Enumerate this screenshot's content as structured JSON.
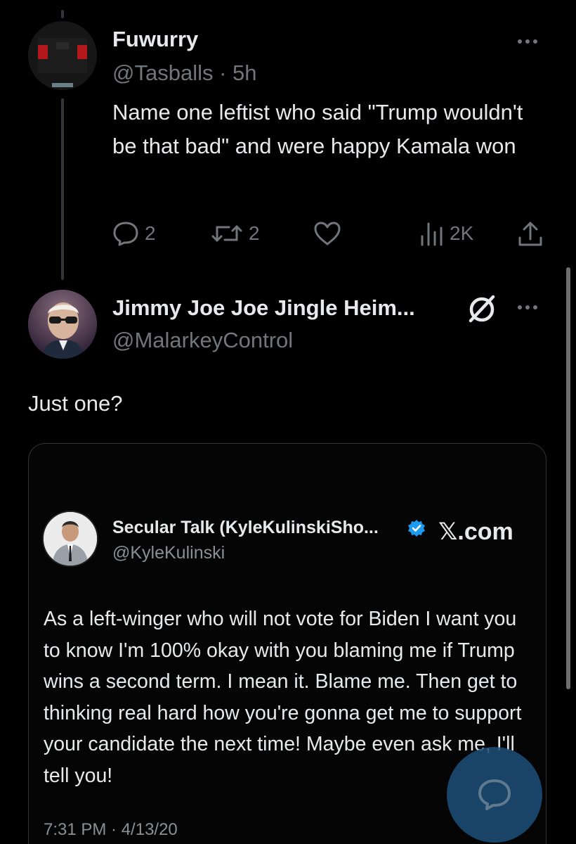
{
  "tweet1": {
    "name": "Fuwurry",
    "handle_time": "@Tasballs · 5h",
    "text": "Name one leftist who said \"Trump wouldn't be that bad\" and were happy Kamala won",
    "replies": "2",
    "retweets": "2",
    "views": "2K"
  },
  "tweet2": {
    "name": "Jimmy Joe Joe Jingle Heim...",
    "handle": "@MalarkeyControl",
    "text": "Just one?"
  },
  "quote": {
    "name": "Secular Talk (KyleKulinskiSho...",
    "handle": "@KyleKulinski",
    "site": "𝕏.com",
    "text": "As a left-winger who will not vote for Biden I want you to know I'm 100% okay with you blaming me if Trump wins a second term. I mean it. Blame me. Then get to thinking real hard how you're gonna get me to support your candidate the next time! Maybe even ask me, I'll tell you!",
    "timestamp": "7:31 PM · 4/13/20"
  },
  "icons": {
    "reply": "reply-icon",
    "retweet": "retweet-icon",
    "like": "like-icon",
    "views": "views-icon",
    "share": "share-icon",
    "verified": "verified-badge-icon",
    "compose": "compose-reply-icon"
  },
  "colors": {
    "background": "#000000",
    "text": "#e7e9ea",
    "muted": "#71767b",
    "verified": "#1d9bf0",
    "fab": "#1d4f7a"
  }
}
